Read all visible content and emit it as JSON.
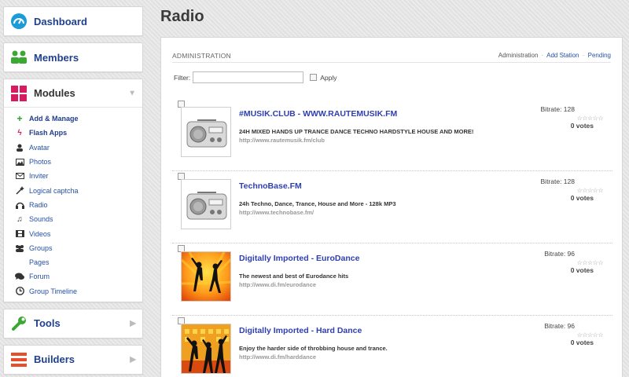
{
  "sidebar": {
    "dashboard": "Dashboard",
    "members": "Members",
    "modules": "Modules",
    "tools": "Tools",
    "builders": "Builders",
    "items": [
      {
        "label": "Add & Manage",
        "icon": "plus-icon"
      },
      {
        "label": "Flash Apps",
        "icon": "flash-icon"
      },
      {
        "label": "Avatar",
        "icon": "user-icon"
      },
      {
        "label": "Photos",
        "icon": "photo-icon"
      },
      {
        "label": "Inviter",
        "icon": "envelope-icon"
      },
      {
        "label": "Logical captcha",
        "icon": "wand-icon"
      },
      {
        "label": "Radio",
        "icon": "headphones-icon"
      },
      {
        "label": "Sounds",
        "icon": "music-icon"
      },
      {
        "label": "Videos",
        "icon": "film-icon"
      },
      {
        "label": "Groups",
        "icon": "group-icon"
      },
      {
        "label": "Pages",
        "icon": ""
      },
      {
        "label": "Forum",
        "icon": "comments-icon"
      },
      {
        "label": "Group Timeline",
        "icon": "clock-icon"
      }
    ]
  },
  "page": {
    "title": "Radio",
    "admin_label": "ADMINISTRATION",
    "links": {
      "administration": "Administration",
      "add_station": "Add Station",
      "pending": "Pending"
    },
    "filter_label": "Filter:",
    "apply_label": "Apply"
  },
  "stations": [
    {
      "name": "#MUSIK.CLUB - WWW.RAUTEMUSIK.FM",
      "desc": "24H MIXED HANDS UP TRANCE DANCE TECHNO HARDSTYLE HOUSE AND MORE!",
      "url": "http://www.rautemusik.fm/club",
      "bitrate": "Bitrate: 128",
      "votes": "0 votes",
      "thumb": "radio"
    },
    {
      "name": "TechnoBase.FM",
      "desc": "24h Techno, Dance, Trance, House and More - 128k MP3",
      "url": "http://www.technobase.fm/",
      "bitrate": "Bitrate: 128",
      "votes": "0 votes",
      "thumb": "radio"
    },
    {
      "name": "Digitally Imported - EuroDance",
      "desc": "The newest and best of Eurodance hits",
      "url": "http://www.di.fm/eurodance",
      "bitrate": "Bitrate: 96",
      "votes": "0 votes",
      "thumb": "dance"
    },
    {
      "name": "Digitally Imported - Hard Dance",
      "desc": "Enjoy the harder side of throbbing house and trance.",
      "url": "http://www.di.fm/harddance",
      "bitrate": "Bitrate: 96",
      "votes": "0 votes",
      "thumb": "dance2"
    }
  ],
  "colors": {
    "link": "#2650a6",
    "title_link": "#2f3fb0",
    "modules_pink": "#d81b60"
  }
}
